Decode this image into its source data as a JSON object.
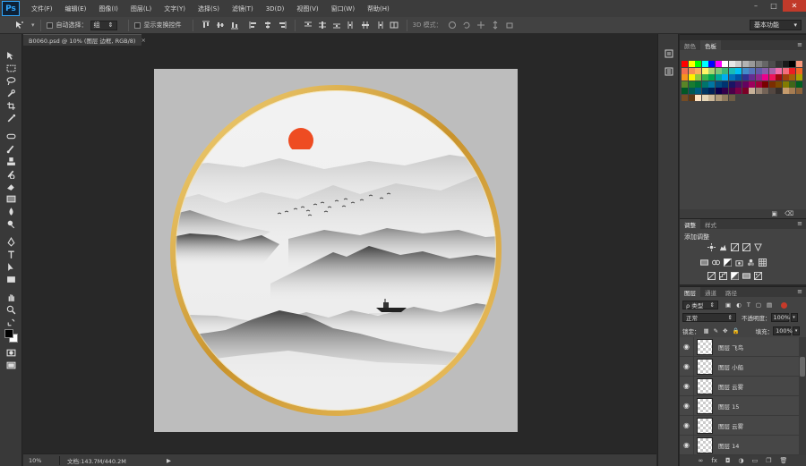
{
  "app": {
    "logo": "Ps"
  },
  "menu": [
    "文件(F)",
    "编辑(E)",
    "图像(I)",
    "图层(L)",
    "文字(Y)",
    "选择(S)",
    "滤镜(T)",
    "3D(D)",
    "视图(V)",
    "窗口(W)",
    "帮助(H)"
  ],
  "window_controls": {
    "minimize": "–",
    "maximize": "□",
    "close": "✕"
  },
  "options": {
    "auto_select_label": "自动选择：",
    "auto_select_value": "组",
    "show_transform_label": "显示变换控件",
    "mode_3d_label": "3D 模式：",
    "workspace": "基本功能"
  },
  "document": {
    "tab_title": "B0060.psd @ 10% (图层 边框, RGB/8)",
    "close_glyph": "×",
    "zoom": "10%",
    "doc_info": "文档:143.7M/440.2M",
    "status_arrow": "▶"
  },
  "swatches_panel": {
    "tabs": [
      "颜色",
      "色板"
    ],
    "active_tab": 1,
    "colors": [
      [
        "#ff0000",
        "#ffff00",
        "#00ff00",
        "#00ffff",
        "#0000ff",
        "#ff00ff",
        "#ffffff",
        "#e6e6e6",
        "#cccccc",
        "#b3b3b3",
        "#999999",
        "#808080",
        "#666666",
        "#4d4d4d",
        "#333333",
        "#1a1a1a",
        "#000000",
        "#f7977a"
      ],
      [
        "#f26c4f",
        "#f68e55",
        "#fbaf5c",
        "#fff467",
        "#acd372",
        "#7cc576",
        "#3bb878",
        "#1abbb4",
        "#00bff3",
        "#438cca",
        "#5574b9",
        "#605ca8",
        "#855fa8",
        "#a763a8",
        "#f06ea9",
        "#f26d7d",
        "#ed1c24",
        "#f26522"
      ],
      [
        "#f7941d",
        "#fff200",
        "#8dc73f",
        "#39b54a",
        "#00a651",
        "#00a99d",
        "#00aeef",
        "#0072bc",
        "#0054a6",
        "#2e3192",
        "#662d91",
        "#92278f",
        "#ec008c",
        "#ed145b",
        "#9e0b0f",
        "#a0410d",
        "#a36209",
        "#aba000"
      ],
      [
        "#598527",
        "#197b30",
        "#007236",
        "#00746b",
        "#0076a3",
        "#004b80",
        "#003471",
        "#1b1464",
        "#440e62",
        "#630460",
        "#9e005d",
        "#9e0039",
        "#790000",
        "#7b2e00",
        "#7d4900",
        "#827b00",
        "#406618",
        "#005e20"
      ],
      [
        "#005826",
        "#005952",
        "#005b7f",
        "#003663",
        "#002157",
        "#0d004c",
        "#32004b",
        "#4b0049",
        "#7b0046",
        "#7a0026",
        "#c7b299",
        "#998675",
        "#736357",
        "#534741",
        "#37302d",
        "#c69c6d",
        "#a67c52",
        "#8c6239"
      ],
      [
        "#754c24",
        "#603913",
        "#ffe4c4",
        "#e6d7b9",
        "#cdb99a",
        "#b09a7a",
        "#8f7b5e",
        "#6e5d45"
      ]
    ]
  },
  "adjustments_panel": {
    "tabs": [
      "调整",
      "样式"
    ],
    "title": "添加调整"
  },
  "layers_panel": {
    "tabs": [
      "图层",
      "通道",
      "路径"
    ],
    "filter_label": "ρ 类型",
    "blend_mode": "正常",
    "opacity_label": "不透明度：",
    "opacity_value": "100%",
    "lock_label": "锁定：",
    "fill_label": "填充：",
    "fill_value": "100%",
    "layers": [
      {
        "name": "图层 飞鸟"
      },
      {
        "name": "图层 小船"
      },
      {
        "name": "图层 云雾"
      },
      {
        "name": "图层 15"
      },
      {
        "name": "图层 云雾"
      },
      {
        "name": "图层 14"
      }
    ],
    "footer_icons": [
      "∞",
      "fx",
      "◘",
      "◑",
      "▭",
      "❐",
      "🗑"
    ]
  },
  "artwork": {
    "frame_color": "#d4a53c",
    "sun_color": "#ee4c22"
  }
}
